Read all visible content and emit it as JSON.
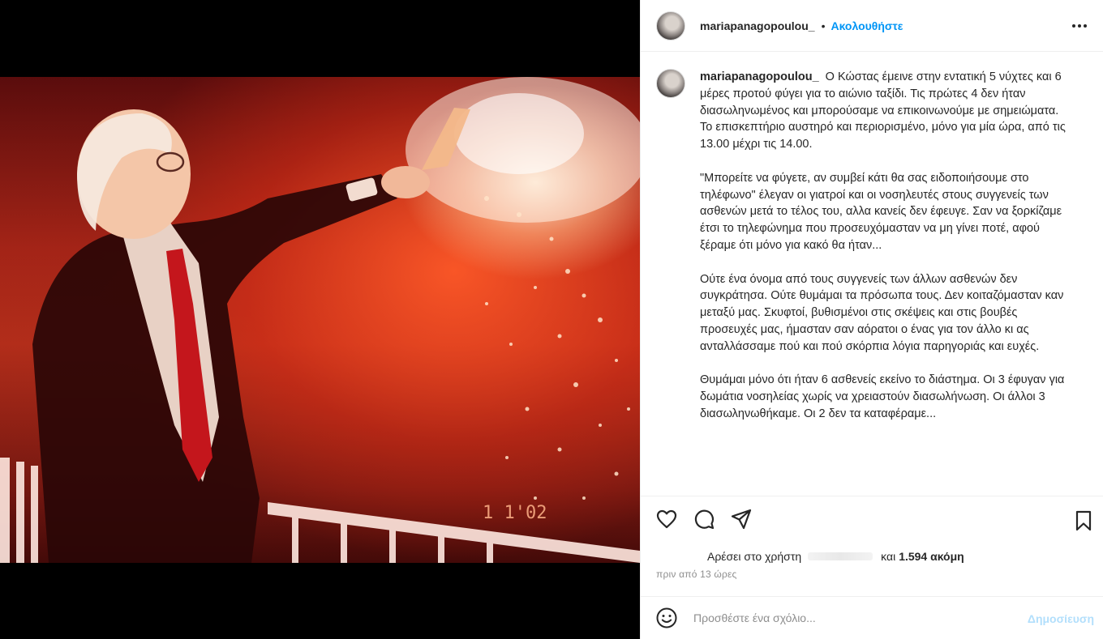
{
  "post": {
    "username": "mariapanagopoulou_",
    "dot": "•",
    "follow_label": "Ακολουθήστε"
  },
  "caption": {
    "username": "mariapanagopoulou_",
    "paragraphs": [
      "Ο Κώστας έμεινε στην εντατική 5 νύχτες και 6 μέρες προτού φύγει για το αιώνιο ταξίδι. Τις πρώτες 4 δεν ήταν διασωληνωμένος και μπορούσαμε να επικοινωνούμε με σημειώματα. Το επισκεπτήριο αυστηρό και περιορισμένο, μόνο για μία ώρα, από τις 13.00 μέχρι τις 14.00.",
      "\"Μπορείτε να φύγετε, αν συμβεί κάτι θα σας ειδοποιήσουμε στο τηλέφωνο\" έλεγαν οι γιατροί και οι νοσηλευτές στους συγγενείς των ασθενών μετά το τέλος του, αλλα κανείς δεν έφευγε. Σαν να ξορκίζαμε έτσι το τηλεφώνημα που προσευχόμασταν να μη γίνει ποτέ, αφού ξέραμε ότι μόνο για κακό θα ήταν...",
      "Ούτε ένα όνομα από τους συγγενείς των άλλων ασθενών δεν συγκράτησα. Ούτε θυμάμαι τα πρόσωπα τους. Δεν κοιταζόμασταν καν μεταξύ μας. Σκυφτοί, βυθισμένοι στις σκέψεις και στις βουβές προσευχές μας, ήμασταν σαν αόρατοι ο ένας για τον άλλο κι ας ανταλλάσσαμε πού και πού σκόρπια λόγια παρηγοριάς και ευχές.",
      "Θυμάμαι μόνο ότι ήταν 6 ασθενείς εκείνο το διάστημα. Οι 3 έφυγαν για δωμάτια νοσηλείας χωρίς να χρειαστούν διασωλήνωση. Οι άλλοι 3 διασωληνωθήκαμε. Οι 2 δεν τα καταφέραμε..."
    ]
  },
  "photo": {
    "timestamp_overlay": "1 1'02"
  },
  "likes": {
    "prefix": "Αρέσει στο χρήστη",
    "conjunction": "και",
    "count_text": "1.594 ακόμη"
  },
  "time_ago": "πριν από 13 ώρες",
  "comment": {
    "placeholder": "Προσθέστε ένα σχόλιο...",
    "post_label": "Δημοσίευση"
  },
  "icons": {
    "more": "more-options-icon",
    "like": "heart-icon",
    "comment": "comment-icon",
    "share": "paper-plane-icon",
    "save": "bookmark-icon",
    "emoji": "emoji-icon"
  }
}
